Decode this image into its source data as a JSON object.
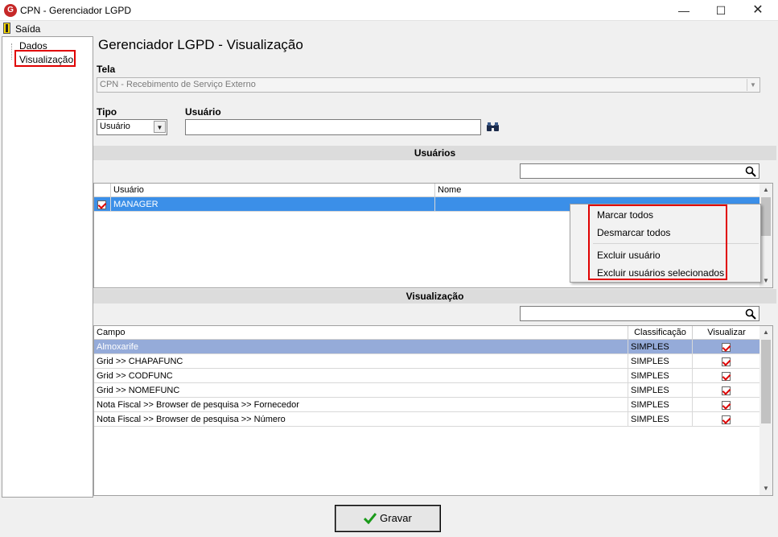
{
  "window": {
    "app_icon_letter": "G",
    "title": "CPN - Gerenciador LGPD",
    "min": "—",
    "max": "☐",
    "close": "✕"
  },
  "menu": {
    "exit_label": "Saída"
  },
  "tree": {
    "items": [
      {
        "label": "Dados"
      },
      {
        "label": "Visualização"
      }
    ]
  },
  "main": {
    "title": "Gerenciador LGPD - Visualização",
    "tela_label": "Tela",
    "tela_value": "CPN - Recebimento de Serviço Externo",
    "tipo_label": "Tipo",
    "tipo_value": "Usuário",
    "usuario_label": "Usuário",
    "usuario_value": ""
  },
  "usuarios": {
    "header": "Usuários",
    "search_value": "",
    "columns": [
      "Usuário",
      "Nome"
    ],
    "rows": [
      {
        "checked": true,
        "usuario": "MANAGER",
        "nome": ""
      }
    ]
  },
  "context_menu": {
    "items": [
      "Marcar todos",
      "Desmarcar todos",
      "Excluir usuário",
      "Excluir usuários selecionados"
    ]
  },
  "visualizacao": {
    "header": "Visualização",
    "search_value": "",
    "columns": [
      "Campo",
      "Classificação",
      "Visualizar"
    ],
    "rows": [
      {
        "campo": "Almoxarife",
        "classificacao": "SIMPLES",
        "visualizar": true
      },
      {
        "campo": "Grid >> CHAPAFUNC",
        "classificacao": "SIMPLES",
        "visualizar": true
      },
      {
        "campo": "Grid >> CODFUNC",
        "classificacao": "SIMPLES",
        "visualizar": true
      },
      {
        "campo": "Grid >> NOMEFUNC",
        "classificacao": "SIMPLES",
        "visualizar": true
      },
      {
        "campo": "Nota Fiscal >> Browser de pesquisa >> Fornecedor",
        "classificacao": "SIMPLES",
        "visualizar": true
      },
      {
        "campo": "Nota Fiscal >> Browser de pesquisa >> Número",
        "classificacao": "SIMPLES",
        "visualizar": true
      }
    ]
  },
  "footer": {
    "save_label": "Gravar"
  },
  "colors": {
    "selection": "#3b8fe8",
    "first_row": "#95abd9",
    "highlight_box": "#e00000",
    "check": "#dd0000"
  }
}
